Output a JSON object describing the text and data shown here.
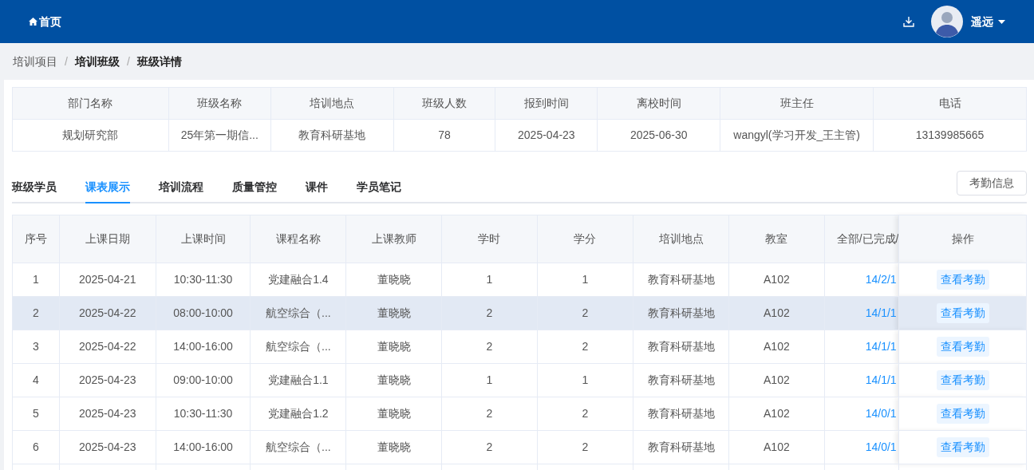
{
  "header": {
    "home_link": "首页",
    "user": {
      "name": "遥远"
    }
  },
  "breadcrumb": [
    "培训项目",
    "培训班级",
    "班级详情"
  ],
  "breadcrumb_separator": "/",
  "info_table": {
    "columns": [
      "部门名称",
      "班级名称",
      "培训地点",
      "班级人数",
      "报到时间",
      "离校时间",
      "班主任",
      "电话"
    ],
    "row": [
      "规划研究部",
      "25年第一期信...",
      "教育科研基地",
      "78",
      "2025-04-23",
      "2025-06-30",
      "wangyl(学习开发_王主管)",
      "13139985665"
    ]
  },
  "tabs": [
    {
      "label": "班级学员",
      "selected": false
    },
    {
      "label": "课表展示",
      "selected": true
    },
    {
      "label": "培训流程",
      "selected": false
    },
    {
      "label": "质量管控",
      "selected": false
    },
    {
      "label": "课件",
      "selected": false
    },
    {
      "label": "学员笔记",
      "selected": false
    }
  ],
  "attendance_button": "考勤信息",
  "schedule_table": {
    "columns": [
      "序号",
      "上课日期",
      "上课时间",
      "课程名称",
      "上课教师",
      "学时",
      "学分",
      "培训地点",
      "教室",
      "全部/已完成/",
      "操作"
    ],
    "rows": [
      {
        "highlighted": false,
        "cells": [
          "1",
          "2025-04-21",
          "10:30-11:30",
          "党建融合1.4",
          "董晓晓",
          "1",
          "1",
          "教育科研基地",
          "A102",
          "14/2/1"
        ],
        "action": "查看考勤"
      },
      {
        "highlighted": true,
        "cells": [
          "2",
          "2025-04-22",
          "08:00-10:00",
          "航空综合（...",
          "董晓晓",
          "2",
          "2",
          "教育科研基地",
          "A102",
          "14/1/1"
        ],
        "action": "查看考勤"
      },
      {
        "highlighted": false,
        "cells": [
          "3",
          "2025-04-22",
          "14:00-16:00",
          "航空综合（...",
          "董晓晓",
          "2",
          "2",
          "教育科研基地",
          "A102",
          "14/1/1"
        ],
        "action": "查看考勤"
      },
      {
        "highlighted": false,
        "cells": [
          "4",
          "2025-04-23",
          "09:00-10:00",
          "党建融合1.1",
          "董晓晓",
          "1",
          "1",
          "教育科研基地",
          "A102",
          "14/1/1"
        ],
        "action": "查看考勤"
      },
      {
        "highlighted": false,
        "cells": [
          "5",
          "2025-04-23",
          "10:30-11:30",
          "党建融合1.2",
          "董晓晓",
          "2",
          "2",
          "教育科研基地",
          "A102",
          "14/0/1"
        ],
        "action": "查看考勤"
      },
      {
        "highlighted": false,
        "cells": [
          "6",
          "2025-04-23",
          "14:00-16:00",
          "航空综合（...",
          "董晓晓",
          "2",
          "2",
          "教育科研基地",
          "A102",
          "14/0/1"
        ],
        "action": "查看考勤"
      }
    ]
  }
}
